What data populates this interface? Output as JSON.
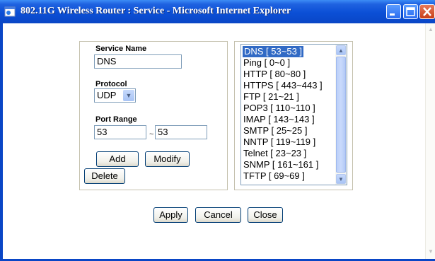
{
  "window": {
    "title": "802.11G Wireless Router : Service - Microsoft Internet Explorer"
  },
  "form": {
    "service_name_label": "Service Name",
    "service_name_value": "DNS",
    "protocol_label": "Protocol",
    "protocol_value": "UDP",
    "port_range_label": "Port Range",
    "port_start": "53",
    "port_separator": "~",
    "port_end": "53",
    "add_label": "Add",
    "modify_label": "Modify",
    "delete_label": "Delete"
  },
  "service_list": {
    "items": [
      "DNS [ 53~53 ]",
      "Ping [ 0~0 ]",
      "HTTP [ 80~80 ]",
      "HTTPS [ 443~443 ]",
      "FTP [ 21~21 ]",
      "POP3 [ 110~110 ]",
      "IMAP [ 143~143 ]",
      "SMTP [ 25~25 ]",
      "NNTP [ 119~119 ]",
      "Telnet [ 23~23 ]",
      "SNMP [ 161~161 ]",
      "TFTP [ 69~69 ]"
    ],
    "selected_index": 0
  },
  "actions": {
    "apply_label": "Apply",
    "cancel_label": "Cancel",
    "close_label": "Close"
  },
  "icons": {
    "window_icon": "ie-page-icon",
    "dropdown": "chevron-down-icon",
    "scroll_up": "chevron-up-icon",
    "scroll_down": "chevron-down-icon"
  }
}
